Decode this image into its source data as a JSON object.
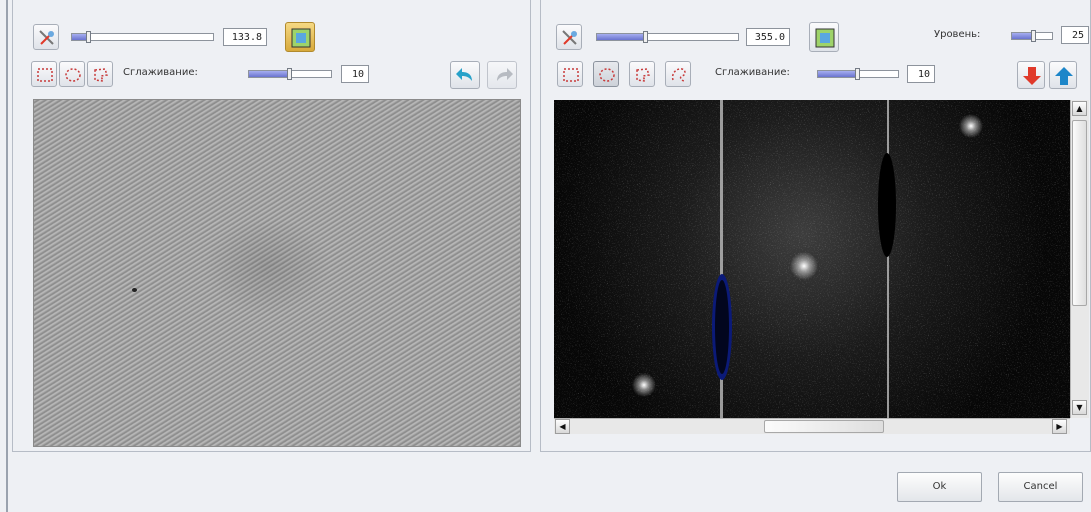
{
  "left": {
    "threshold_value": "133.8",
    "threshold_fraction": 0.12,
    "smoothing_label": "Сглаживание:",
    "smoothing_value": "10",
    "smoothing_fraction": 0.5
  },
  "right": {
    "threshold_value": "355.0",
    "threshold_fraction": 0.35,
    "level_label": "Уровень:",
    "level_value": "25",
    "level_fraction": 0.55,
    "smoothing_label": "Сглаживание:",
    "smoothing_value": "10",
    "smoothing_fraction": 0.5
  },
  "dialog": {
    "ok_label": "Ok",
    "cancel_label": "Cancel"
  },
  "colors": {
    "accent": "#6a73cf",
    "arrow_down": "#e0392a",
    "arrow_up": "#1d86c9",
    "mask_dark": "#000000",
    "mask_blue": "#0b1a78"
  }
}
